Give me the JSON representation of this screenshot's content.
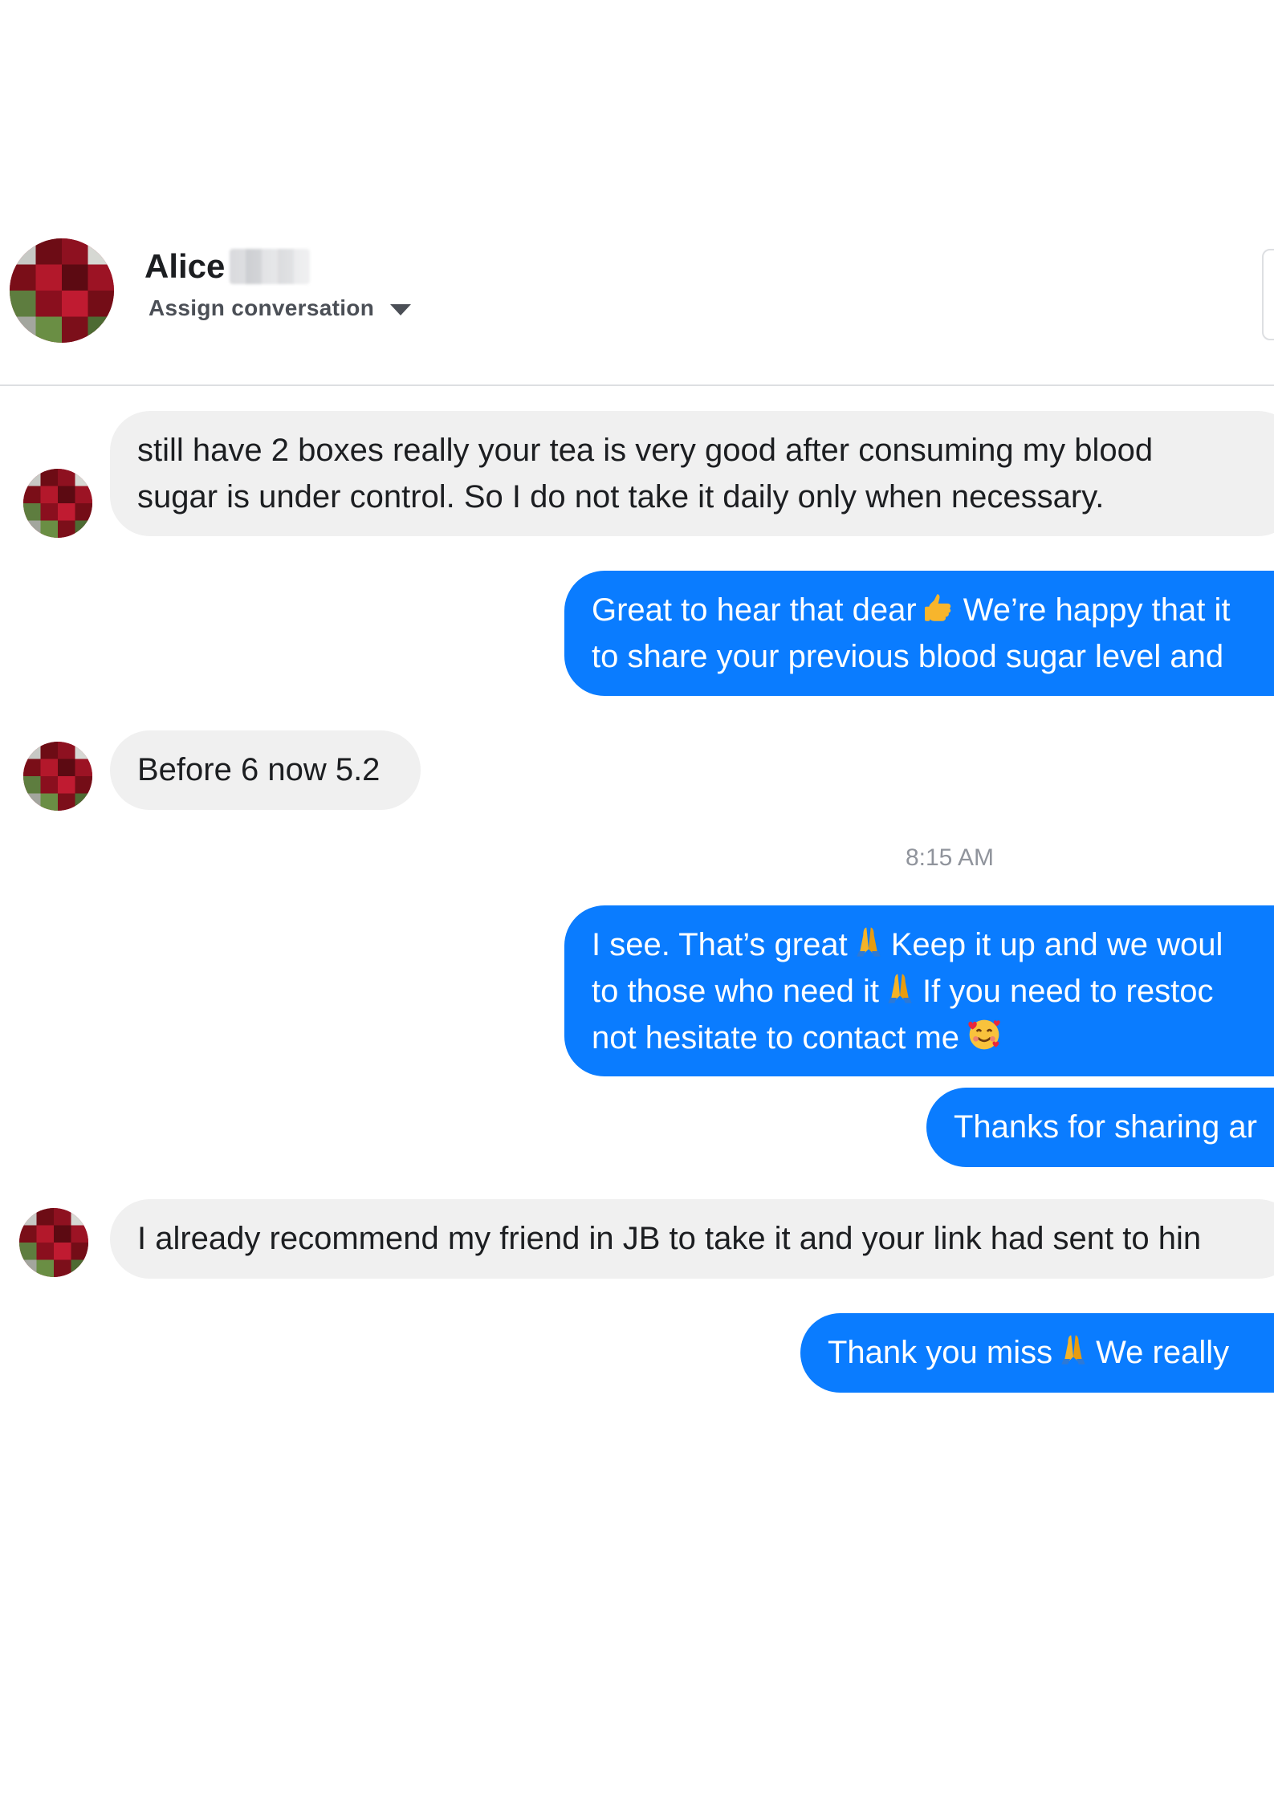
{
  "header": {
    "contact_name": "Alice",
    "assign_label": "Assign conversation"
  },
  "colors": {
    "outgoing_bubble": "#0a7cff",
    "incoming_bubble": "#f0f0f0",
    "avatar_primary": "#8b0f1c"
  },
  "icons": {
    "thumbs_up": "thumbs-up-icon",
    "folded_hands": "folded-hands-icon",
    "smiling_hearts": "smiling-face-with-hearts-icon",
    "assign_dropdown": "chevron-down-icon"
  },
  "messages": {
    "m1": {
      "line1": "still have 2 boxes   really your tea is very good after consuming my blood",
      "line2": "sugar is under control. So I do not take it daily only when necessary."
    },
    "m2": {
      "line1_a": "Great to hear that dear",
      "line1_b": "We’re happy that it",
      "line2": "to share your previous blood sugar level and"
    },
    "m3": {
      "text": "Before 6 now 5.2"
    },
    "timestamp": "8:15 AM",
    "m4": {
      "line1_a": "I see. That’s great",
      "line1_b": "Keep it up and we woul",
      "line2_a": "to those who need it",
      "line2_b": "If you need to restoc",
      "line3": "not hesitate to contact me"
    },
    "m5": {
      "text": "Thanks for sharing ar"
    },
    "m6": {
      "text": "I already recommend my friend in JB to take it and your link had sent to hin"
    },
    "m7": {
      "text_a": "Thank you miss",
      "text_b": "We really"
    }
  }
}
